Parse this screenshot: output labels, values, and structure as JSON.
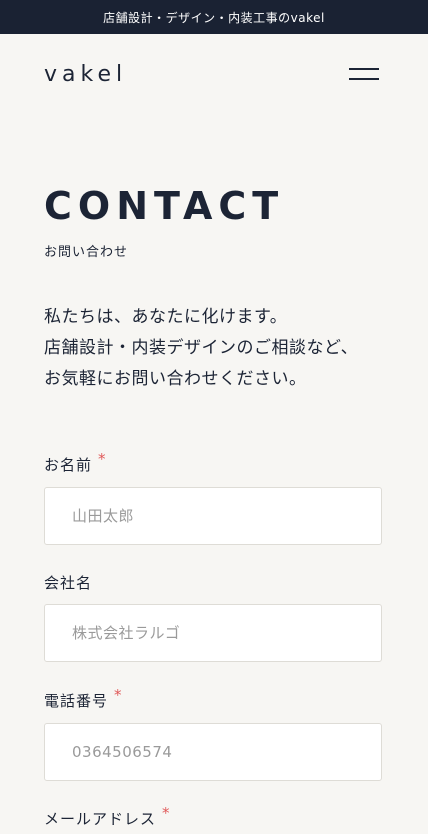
{
  "topbar": {
    "text": "店舗設計・デザイン・内装工事のvakel"
  },
  "header": {
    "logo": "vakel"
  },
  "page": {
    "title": "CONTACT",
    "subtitle": "お問い合わせ",
    "intro": [
      "私たちは、あなたに化けます。",
      "店舗設計・内装デザインのご相談など、",
      "お気軽にお問い合わせください。"
    ]
  },
  "form": {
    "name": {
      "label": "お名前",
      "required_mark": "*",
      "placeholder": "山田太郎",
      "value": ""
    },
    "company": {
      "label": "会社名",
      "placeholder": "株式会社ラルゴ",
      "value": ""
    },
    "phone": {
      "label": "電話番号",
      "required_mark": "*",
      "placeholder": "0364506574",
      "value": ""
    },
    "email": {
      "label": "メールアドレス",
      "required_mark": "*"
    }
  },
  "colors": {
    "navy": "#1a2233",
    "background": "#f7f6f3",
    "required": "#e05a5a"
  },
  "icons": {
    "menu": "hamburger-menu-icon"
  }
}
